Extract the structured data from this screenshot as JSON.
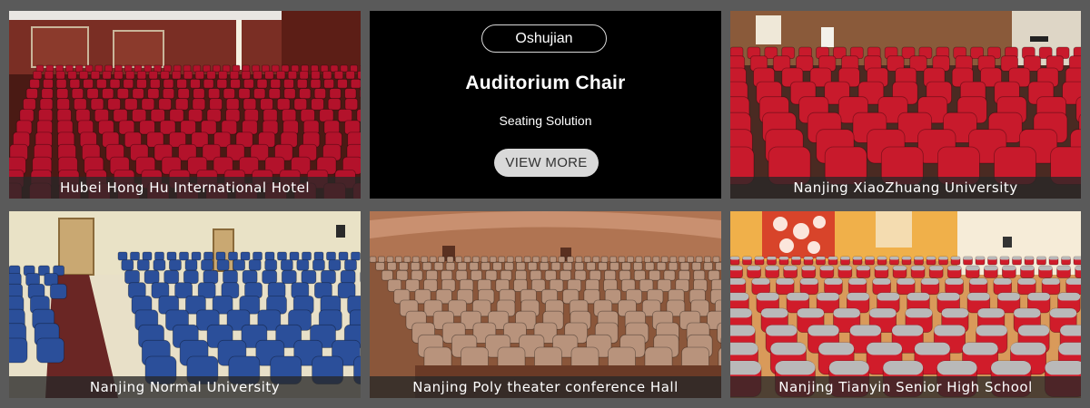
{
  "promo": {
    "brand": "Oshujian",
    "title": "Auditorium Chair",
    "subtitle": "Seating Solution",
    "cta_label": "VIEW MORE"
  },
  "tiles": [
    {
      "caption": "Hubei Hong Hu International Hotel",
      "seat_color": "#b3122b",
      "wall_color": "#6e2a22"
    },
    {
      "caption": "Nanjing XiaoZhuang University",
      "seat_color": "#c81a2c",
      "wall_color": "#8a5a3a"
    },
    {
      "caption": "Nanjing Normal University",
      "seat_color": "#2b4f9a",
      "wall_color": "#e8e0c8"
    },
    {
      "caption": "Nanjing Poly theater conference Hall",
      "seat_color": "#b8937c",
      "wall_color": "#a86a48"
    },
    {
      "caption": "Nanjing Tianyin Senior High School",
      "seat_color": "#d01c2a",
      "wall_color": "#f0b04a"
    }
  ]
}
